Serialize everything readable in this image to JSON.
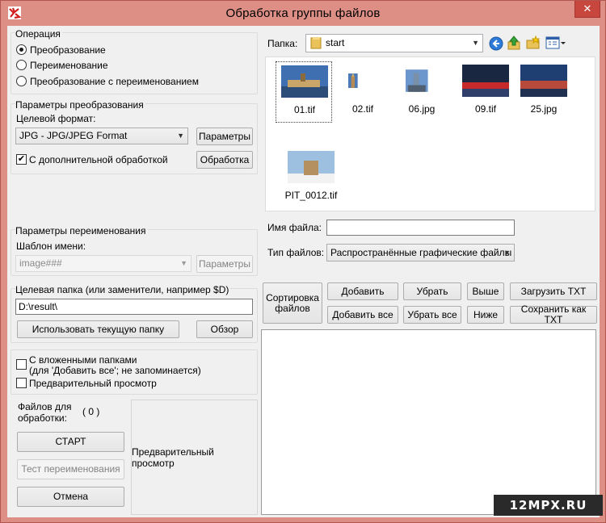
{
  "window": {
    "title": "Обработка группы файлов",
    "close_glyph": "✕"
  },
  "operation": {
    "group_title": "Операция",
    "options": [
      {
        "label": "Преобразование",
        "selected": true
      },
      {
        "label": "Переименование",
        "selected": false
      },
      {
        "label": "Преобразование с переименованием",
        "selected": false
      }
    ]
  },
  "convert": {
    "group_title": "Параметры преобразования",
    "format_label": "Целевой формат:",
    "format_value": "JPG - JPG/JPEG Format",
    "params_button": "Параметры",
    "extra_checkbox_label": "С дополнительной обработкой",
    "extra_checked": true,
    "processing_button": "Обработка"
  },
  "rename": {
    "group_title": "Параметры переименования",
    "template_label": "Шаблон имени:",
    "template_value": "image###",
    "params_button": "Параметры"
  },
  "target": {
    "group_title": "Целевая папка (или заменители, например $D)",
    "path_value": "D:\\result\\",
    "use_current_button": "Использовать текущую папку",
    "browse_button": "Обзор"
  },
  "options": {
    "subfolders_label_line1": "С вложенными папками",
    "subfolders_label_line2": "(для 'Добавить все'; не запоминается)",
    "subfolders_checked": false,
    "preview_label": "Предварительный просмотр",
    "preview_checked": false
  },
  "run": {
    "files_label_line1": "Файлов для",
    "files_label_line2": "обработки:",
    "files_count": "( 0 )",
    "start_button": "СТАРТ",
    "test_rename_button": "Тест переименования",
    "cancel_button": "Отмена",
    "preview_panel_text": "Предварительный просмотр"
  },
  "browser": {
    "folder_label": "Папка:",
    "folder_value": "start",
    "files": [
      {
        "name": "01.tif",
        "selected": true
      },
      {
        "name": "02.tif",
        "selected": false
      },
      {
        "name": "06.jpg",
        "selected": false
      },
      {
        "name": "09.tif",
        "selected": false
      },
      {
        "name": "25.jpg",
        "selected": false
      },
      {
        "name": "PIT_0012.tif",
        "selected": false
      }
    ],
    "filename_label": "Имя файла:",
    "filename_value": "",
    "filetype_label": "Тип файлов:",
    "filetype_value": "Распространённые графические файлы"
  },
  "list_buttons": {
    "sort": "Сортировка файлов",
    "add": "Добавить",
    "remove": "Убрать",
    "up": "Выше",
    "load_txt": "Загрузить TXT",
    "add_all": "Добавить все",
    "remove_all": "Убрать все",
    "down": "Ниже",
    "save_txt": "Сохранить как TXT"
  },
  "watermark": "12MPX.RU"
}
